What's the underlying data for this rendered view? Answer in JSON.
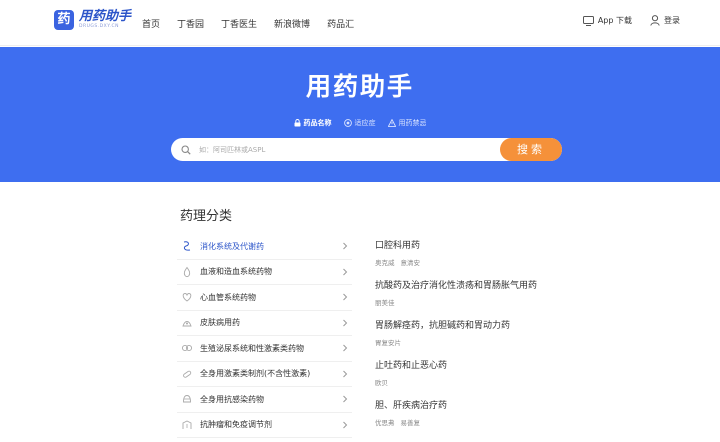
{
  "header": {
    "logo_mark": "药",
    "logo_title": "用药助手",
    "logo_sub": "DRUGS.DXY.CN",
    "nav": [
      "首页",
      "丁香园",
      "丁香医生",
      "新浪微博",
      "药品汇"
    ],
    "app_download": "App 下载",
    "login": "登录"
  },
  "hero": {
    "title": "用药助手",
    "tabs": [
      "药品名称",
      "适应症",
      "用药禁忌"
    ],
    "search_placeholder": "如：阿司匹林或ASPL",
    "search_button": "搜索"
  },
  "section": {
    "title": "药理分类",
    "categories": [
      {
        "label": "消化系统及代谢药",
        "icon": "digestive-icon"
      },
      {
        "label": "血液和造血系统药物",
        "icon": "blood-icon"
      },
      {
        "label": "心血管系统药物",
        "icon": "heart-icon"
      },
      {
        "label": "皮肤病用药",
        "icon": "skin-icon"
      },
      {
        "label": "生殖泌尿系统和性激素类药物",
        "icon": "urogenital-icon"
      },
      {
        "label": "全身用激素类制剂(不含性激素)",
        "icon": "hormone-icon"
      },
      {
        "label": "全身用抗感染药物",
        "icon": "anti-infective-icon"
      },
      {
        "label": "抗肿瘤和免疫调节剂",
        "icon": "antitumor-icon"
      }
    ],
    "subcategories": [
      {
        "title": "口腔科用药",
        "drugs": [
          "奥克威",
          "意清安"
        ]
      },
      {
        "title": "抗酸药及治疗消化性溃疡和胃肠胀气用药",
        "drugs": [
          "丽美佳"
        ]
      },
      {
        "title": "胃肠解痉药，抗胆碱药和胃动力药",
        "drugs": [
          "胃复安片"
        ]
      },
      {
        "title": "止吐药和止恶心药",
        "drugs": [
          "欧贝"
        ]
      },
      {
        "title": "胆、肝疾病治疗药",
        "drugs": [
          "优思弗",
          "易善复"
        ]
      }
    ]
  },
  "colors": {
    "brand": "#3e6ef0",
    "search_button": "#f5913a",
    "active_link": "#2c55c9"
  }
}
